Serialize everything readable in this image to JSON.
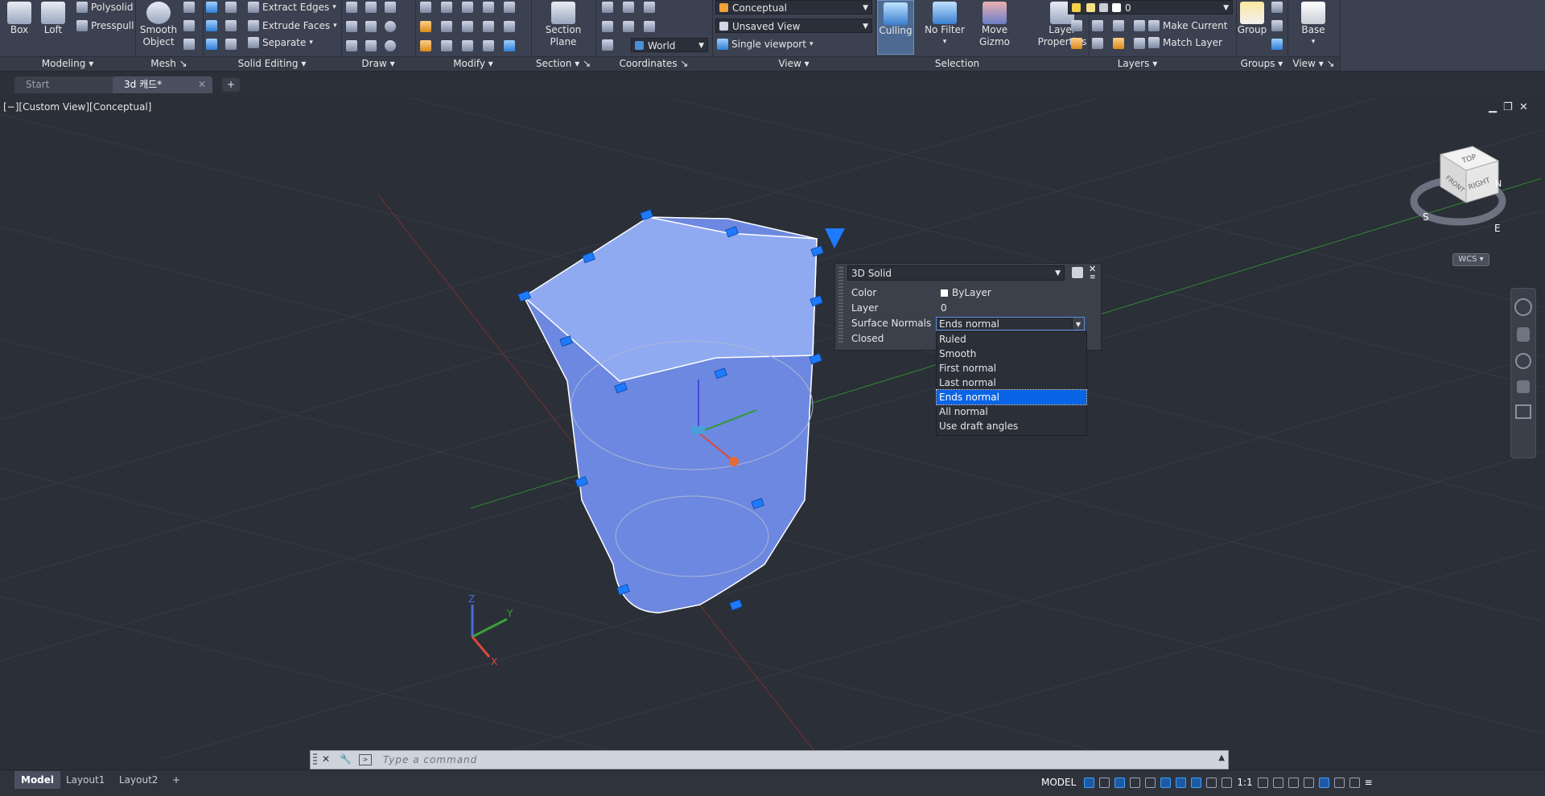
{
  "ribbon": {
    "modeling": {
      "box": "Box",
      "loft": "Loft",
      "polysolid": "Polysolid",
      "presspull": "Presspull",
      "label": "Modeling"
    },
    "mesh": {
      "smooth_object": "Smooth\nObject",
      "label": "Mesh"
    },
    "solid_editing": {
      "extract_edges": "Extract Edges",
      "extrude_faces": "Extrude Faces",
      "separate": "Separate",
      "label": "Solid Editing"
    },
    "draw": {
      "label": "Draw"
    },
    "modify": {
      "label": "Modify"
    },
    "section": {
      "section_plane": "Section\nPlane",
      "label": "Section"
    },
    "coordinates": {
      "world": "World",
      "label": "Coordinates"
    },
    "view": {
      "visual_style": "Conceptual",
      "named_view": "Unsaved View",
      "viewport_config": "Single viewport",
      "label": "View"
    },
    "selection": {
      "culling": "Culling",
      "no_filter": "No Filter",
      "move_gizmo": "Move\nGizmo",
      "label": "Selection"
    },
    "layers": {
      "layer_properties": "Layer\nProperties",
      "current_layer": "0",
      "make_current": "Make Current",
      "match_layer": "Match Layer",
      "label": "Layers"
    },
    "groups": {
      "group": "Group",
      "label": "Groups"
    },
    "view2": {
      "base": "Base",
      "label": "View"
    }
  },
  "file_tabs": [
    {
      "label": "Start"
    },
    {
      "label": "3d 캐드*"
    }
  ],
  "viewport": {
    "label": "[−][Custom View][Conceptual]",
    "viewcube": {
      "top": "TOP",
      "front": "FRONT",
      "right": "RIGHT",
      "compass_s": "S",
      "compass_e": "E",
      "compass_n": "N",
      "wcs": "WCS"
    },
    "ucs": {
      "x": "X",
      "y": "Y",
      "z": "Z"
    }
  },
  "properties_panel": {
    "object_type": "3D Solid",
    "rows": [
      {
        "key": "Color",
        "value": "ByLayer"
      },
      {
        "key": "Layer",
        "value": "0"
      },
      {
        "key": "Surface Normals",
        "value": "Ends normal"
      },
      {
        "key": "Closed",
        "value": ""
      }
    ],
    "surface_normals_options": [
      "Ruled",
      "Smooth",
      "First normal",
      "Last normal",
      "Ends normal",
      "All normal",
      "Use draft angles"
    ],
    "selected_option": "Ends normal"
  },
  "command_line": {
    "placeholder": "Type a command"
  },
  "layout_tabs": [
    {
      "label": "Model"
    },
    {
      "label": "Layout1"
    },
    {
      "label": "Layout2"
    }
  ],
  "status_bar": {
    "model": "MODEL",
    "scale": "1:1"
  },
  "colors": {
    "accent": "#0a64e6",
    "solid_face": "#7b9cf0",
    "grip": "#1e7bff",
    "viewport_bg": "#2b2f38"
  }
}
